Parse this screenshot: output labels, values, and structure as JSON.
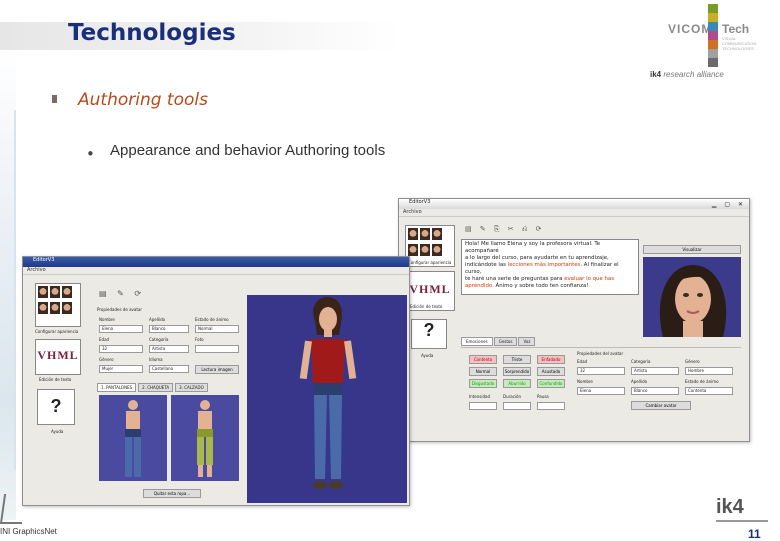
{
  "slide": {
    "title": "Technologies",
    "subtitle": "Authoring tools",
    "bullet_symbol": "•",
    "bullet_text": "Appearance and behavior Authoring tools",
    "page_number": "11"
  },
  "logos": {
    "vicom": "VICOM",
    "tech": "Tech",
    "tech_sub": "VISUAL COMMUNICATION TECHNOLOGIES",
    "ik4_top_prefix": "ik4",
    "ik4_top_rest": "research alliance",
    "ik4_bottom": "ik4",
    "bottom_left": "INI GraphicsNet",
    "bar_colors": [
      "#7a9a2a",
      "#c8b020",
      "#3a8ab8",
      "#b04a8a",
      "#d07020",
      "#a0a0a0",
      "#6a6a6a"
    ]
  },
  "editor_left": {
    "title": "EditorV3",
    "menu": "Archivo",
    "thumb_labels": [
      "Configurar apariencia",
      "Edición de texto",
      "Ayuda"
    ],
    "vhml": "VHML",
    "help_glyph": "?",
    "group_title": "Propiedades de avatar",
    "labels": [
      "Nombre",
      "Apellido",
      "Estado de ánimo",
      "Edad",
      "Categoría",
      "Foto",
      "Género",
      "Idioma"
    ],
    "values": [
      "Elena",
      "Blanco",
      "Normal",
      "32",
      "Artista",
      "Mujer",
      "Castellano"
    ],
    "lecture_button": "Lectura imagen",
    "tabs": [
      "1. PANTALONES",
      "2. CHAQUETA",
      "3. CALZADO"
    ],
    "remove_button": "Quitar esta ropa..."
  },
  "editor_right": {
    "title": "EditorV3",
    "menu": "Archivo",
    "thumb_labels": [
      "Configurar apariencia",
      "Edición de texto",
      "Ayuda"
    ],
    "vhml": "VHML",
    "help_glyph": "?",
    "voice_button": "Visualizar",
    "text_normal_1": "Hola! Me llamo Elena y soy la profesora virtual. Te acompañaré",
    "text_normal_2": "a lo largo del curso, para ayudarte en tu aprendizaje,",
    "text_normal_3": "indicándote las ",
    "text_hl_1": "lecciones más importantes",
    "text_normal_4": ". Al finalizar el curso,",
    "text_normal_5": "te haré una serie de preguntas para ",
    "text_hl_2": "evaluar lo que has",
    "text_hl_3": "aprendido",
    "text_normal_6": ". Ánimo y sobre todo ten confianza!",
    "tabs": [
      "Emociones",
      "Gestos",
      "Voz"
    ],
    "emotion_buttons": [
      "Contento",
      "Triste",
      "Enfadado",
      "Normal",
      "Sorprendido",
      "Asustado",
      "Disgustado",
      "Aburrido",
      "Confundido"
    ],
    "intensity_label": "Intensidad",
    "duration_label": "Duración",
    "weight_label": "Pausa",
    "group_title": "Propiedades del avatar",
    "labels": [
      "Edad",
      "Categoría",
      "Género",
      "Nombre",
      "Apellido",
      "Estado de ánimo"
    ],
    "values": [
      "32",
      "Artista",
      "Hombre",
      "Elena",
      "Blanco",
      "Contenta"
    ],
    "apply_button": "Cambiar avatar"
  }
}
